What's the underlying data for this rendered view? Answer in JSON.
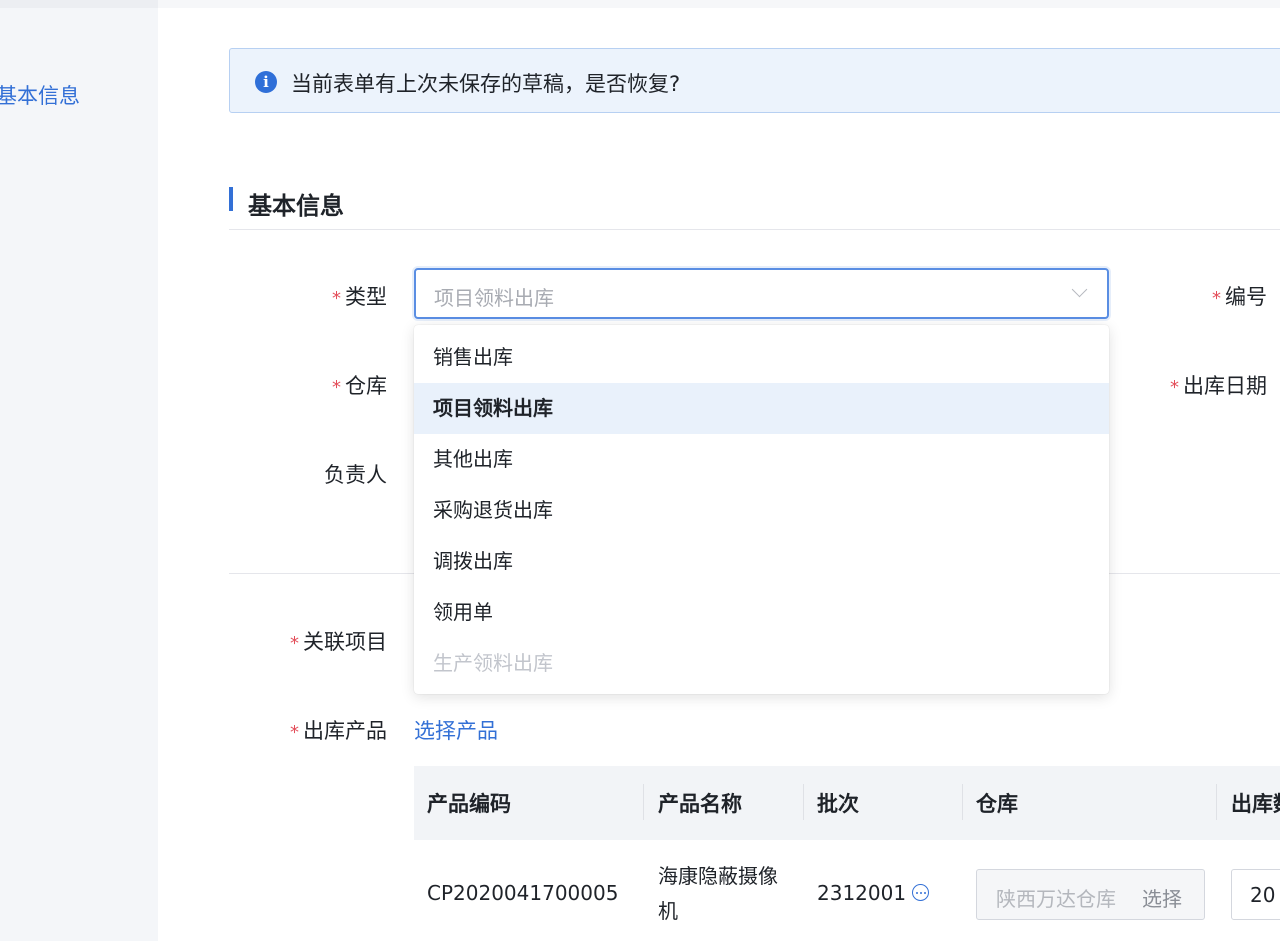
{
  "sidebar": {
    "items": [
      {
        "label": "基本信息"
      }
    ]
  },
  "alert": {
    "icon": "info-icon",
    "text": "当前表单有上次未保存的草稿，是否恢复?"
  },
  "section": {
    "title": "基本信息"
  },
  "form": {
    "type_label": "类型",
    "type_value": "项目领料出库",
    "number_label": "编号",
    "warehouse_label": "仓库",
    "date_label": "出库日期",
    "owner_label": "负责人",
    "project_label": "关联项目",
    "products_label": "出库产品",
    "select_products_link": "选择产品"
  },
  "dropdown": {
    "options": [
      {
        "label": "销售出库",
        "state": "normal"
      },
      {
        "label": "项目领料出库",
        "state": "selected"
      },
      {
        "label": "其他出库",
        "state": "normal"
      },
      {
        "label": "采购退货出库",
        "state": "normal"
      },
      {
        "label": "调拨出库",
        "state": "normal"
      },
      {
        "label": "领用单",
        "state": "normal"
      },
      {
        "label": "生产领料出库",
        "state": "disabled"
      }
    ]
  },
  "table": {
    "headers": [
      "产品编码",
      "产品名称",
      "批次",
      "仓库",
      "出库数"
    ],
    "rows": [
      {
        "code": "CP2020041700005",
        "name": "海康隐蔽摄像机",
        "batch": "2312001",
        "warehouse": "陕西万达仓库",
        "warehouse_button": "选择",
        "qty": "20"
      }
    ]
  }
}
